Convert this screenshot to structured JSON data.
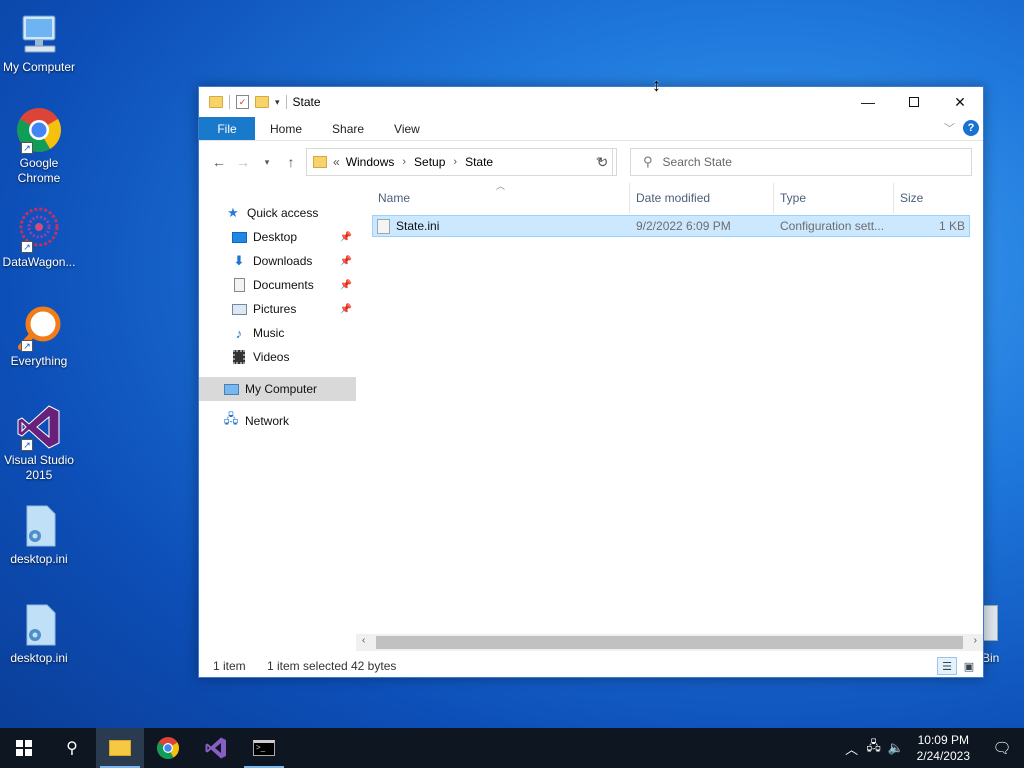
{
  "desktop": {
    "icons": [
      {
        "label": "My Computer",
        "icon": "computer-icon"
      },
      {
        "label": "Google Chrome",
        "icon": "chrome-icon"
      },
      {
        "label": "DataWagon...",
        "icon": "datawagon-icon"
      },
      {
        "label": "Everything",
        "icon": "everything-search-icon"
      },
      {
        "label": "Visual Studio 2015",
        "icon": "visual-studio-icon"
      },
      {
        "label": "desktop.ini",
        "icon": "ini-file-icon"
      },
      {
        "label": "desktop.ini",
        "icon": "ini-file-icon"
      }
    ],
    "recycle_bin_partial_label": "Bin"
  },
  "window": {
    "title": "State",
    "ribbon_tabs": [
      "File",
      "Home",
      "Share",
      "View"
    ],
    "breadcrumb": [
      "Windows",
      "Setup",
      "State"
    ],
    "breadcrumb_overflow": "«",
    "search_placeholder": "Search State",
    "nav_pane": {
      "quick_access": "Quick access",
      "items": [
        {
          "label": "Desktop",
          "pinned": true
        },
        {
          "label": "Downloads",
          "pinned": true
        },
        {
          "label": "Documents",
          "pinned": true
        },
        {
          "label": "Pictures",
          "pinned": true
        },
        {
          "label": "Music",
          "pinned": false
        },
        {
          "label": "Videos",
          "pinned": false
        }
      ],
      "my_computer": "My Computer",
      "network": "Network"
    },
    "columns": [
      "Name",
      "Date modified",
      "Type",
      "Size"
    ],
    "files": [
      {
        "name": "State.ini",
        "date_modified": "9/2/2022 6:09 PM",
        "type": "Configuration sett...",
        "size": "1 KB"
      }
    ],
    "status": {
      "item_count": "1 item",
      "selection": "1 item selected",
      "size": "42 bytes"
    }
  },
  "taskbar": {
    "clock_time": "10:09 PM",
    "clock_date": "2/24/2023"
  },
  "colors": {
    "accent": "#1979ca",
    "selection_bg": "#cce8ff",
    "taskbar": "#0d1621"
  }
}
